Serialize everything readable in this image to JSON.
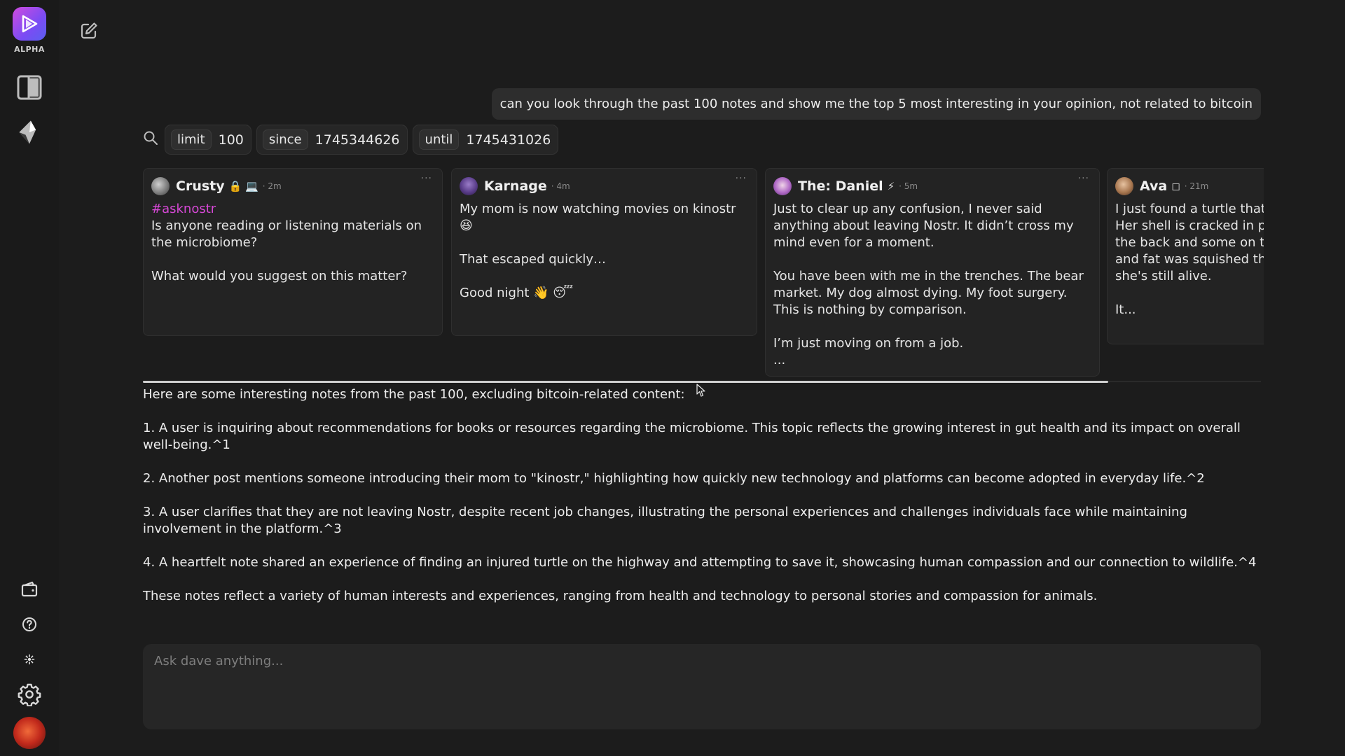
{
  "sidebar": {
    "logo_label": "ALPHA"
  },
  "prompt": {
    "user_message": "can you look through the past 100 notes and show me the top 5 most interesting in your opinion, not related to bitcoin"
  },
  "filters": [
    {
      "key": "limit",
      "value": "100"
    },
    {
      "key": "since",
      "value": "1745344626"
    },
    {
      "key": "until",
      "value": "1745431026"
    }
  ],
  "notes": [
    {
      "name": "Crusty",
      "badge": "🔒 💻",
      "time": "· 2m",
      "hashtag": "#asknostr",
      "body": "Is anyone reading or listening materials on the microbiome?\n\nWhat would you suggest on this matter?"
    },
    {
      "name": "Karnage",
      "badge": "",
      "time": "· 4m",
      "hashtag": "",
      "body": "My mom is now watching movies on kinostr 😆\n\nThat escaped quickly…\n\nGood night 👋 😴"
    },
    {
      "name": "The: Daniel",
      "badge": "⚡",
      "time": "· 5m",
      "hashtag": "",
      "body": "Just to clear up any confusion, I never said anything about leaving Nostr. It didn’t cross my mind even for a moment.\n\nYou have been with me in the trenches. The bear market. My dog almost dying. My foot surgery. This is nothing by comparison.\n\nI’m just moving on from a job.\n..."
    },
    {
      "name": "Ava",
      "badge": "◻",
      "time": "· 21m",
      "hashtag": "",
      "body": "I just found a turtle that was on the highway. Her shell is cracked in places—all the way down the back and some on the bottom. It's visible and fat was squished through the cracks, but she's still alive.\n\nIt..."
    }
  ],
  "answer": {
    "paragraphs": [
      "Here are some interesting notes from the past 100, excluding bitcoin-related content:",
      "1. A user is inquiring about recommendations for books or resources regarding the microbiome. This topic reflects the growing interest in gut health and its impact on overall well-being.^1",
      "2. Another post mentions someone introducing their mom to \"kinostr,\" highlighting how quickly new technology and platforms can become adopted in everyday life.^2",
      "3. A user clarifies that they are not leaving Nostr, despite recent job changes, illustrating the personal experiences and challenges individuals face while maintaining involvement in the platform.^3",
      "4. A heartfelt note shared an experience of finding an injured turtle on the highway and attempting to save it, showcasing human compassion and our connection to wildlife.^4",
      "These notes reflect a variety of human interests and experiences, ranging from health and technology to personal stories and compassion for animals."
    ]
  },
  "ask": {
    "placeholder": "Ask dave anything..."
  }
}
